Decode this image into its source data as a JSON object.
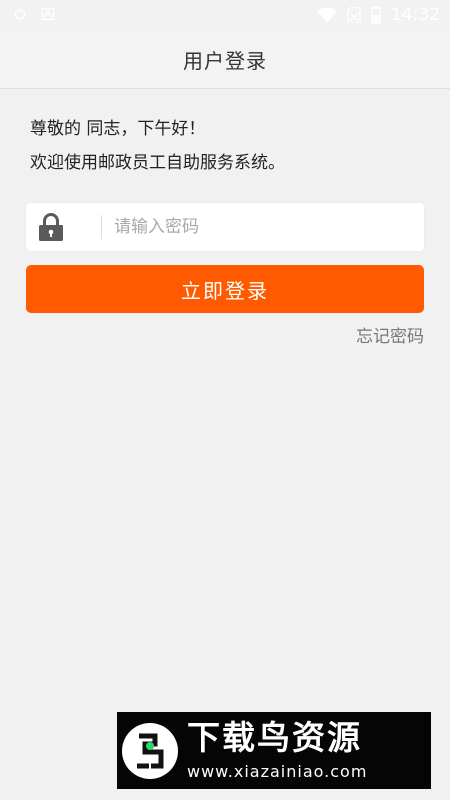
{
  "status_bar": {
    "time": "14:32",
    "icons": [
      "alarm-icon",
      "a-notification-icon",
      "wifi-icon",
      "no-sim-icon",
      "battery-icon"
    ]
  },
  "header": {
    "title": "用户登录"
  },
  "greeting": {
    "line1": "尊敬的 同志，下午好！",
    "line2": "欢迎使用邮政员工自助服务系统。"
  },
  "password": {
    "placeholder": "请输入密码",
    "value": "",
    "icon": "lock-icon"
  },
  "login_button": {
    "label": "立即登录"
  },
  "forgot_link": {
    "label": "忘记密码"
  },
  "watermark": {
    "title": "下载鸟资源",
    "url": "www.xiazainiao.com"
  },
  "colors": {
    "accent": "#ff5a00",
    "background": "#f1f1f1",
    "watermark_bg": "#050505",
    "logo_green": "#2bd66a"
  }
}
